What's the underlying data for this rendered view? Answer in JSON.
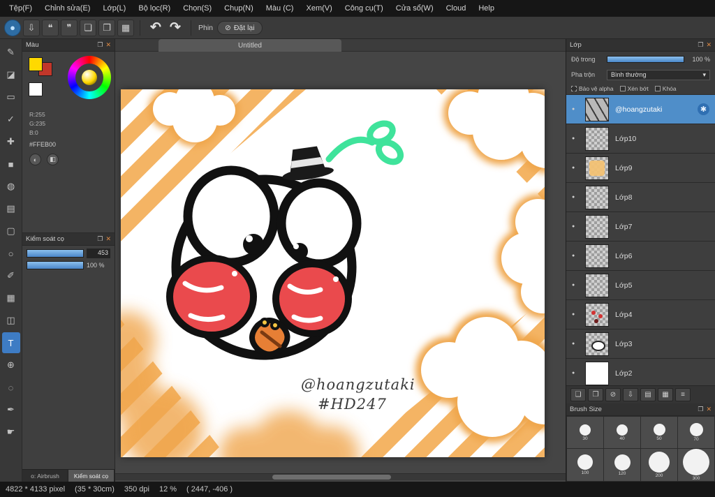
{
  "menubar": {
    "items": [
      "Tệp(F)",
      "Chỉnh sửa(E)",
      "Lớp(L)",
      "Bộ lọc(R)",
      "Chọn(S)",
      "Chụp(N)",
      "Màu (C)",
      "Xem(V)",
      "Công cụ(T)",
      "Cửa sổ(W)",
      "Cloud",
      "Help"
    ]
  },
  "toolbar": {
    "icons": [
      {
        "name": "primary-tool-icon",
        "glyph": "●"
      },
      {
        "name": "save-icon",
        "glyph": "⇩"
      },
      {
        "name": "speech-filled-icon",
        "glyph": "❝"
      },
      {
        "name": "speech-outline-icon",
        "glyph": "❞"
      },
      {
        "name": "page-icon",
        "glyph": "❏"
      },
      {
        "name": "panels-icon",
        "glyph": "❐"
      },
      {
        "name": "grid-icon",
        "glyph": "▦"
      }
    ],
    "undo_glyph": "↶",
    "redo_glyph": "↷",
    "pen_label": "Phin",
    "reset_icon": "⊘",
    "reset_label": "Đặt lại"
  },
  "tools": {
    "items": [
      {
        "name": "pen-tool",
        "glyph": "✎"
      },
      {
        "name": "eraser-tool",
        "glyph": "◪"
      },
      {
        "name": "select-tool",
        "glyph": "▭"
      },
      {
        "name": "select-pen-tool",
        "glyph": "✓"
      },
      {
        "name": "move-tool",
        "glyph": "✚"
      },
      {
        "name": "fill-rect-tool",
        "glyph": "■"
      },
      {
        "name": "bucket-tool",
        "glyph": "◍"
      },
      {
        "name": "gradient-tool",
        "glyph": "▤"
      },
      {
        "name": "frame-tool",
        "glyph": "▢"
      },
      {
        "name": "ellipse-tool",
        "glyph": "○"
      },
      {
        "name": "eyedropper-tool",
        "glyph": "✐"
      },
      {
        "name": "divide-tool",
        "glyph": "▦"
      },
      {
        "name": "panel-tool",
        "glyph": "◫"
      },
      {
        "name": "text-tool",
        "glyph": "T",
        "selected": true
      },
      {
        "name": "zoom-tool",
        "glyph": "⊕"
      },
      {
        "name": "lasso-tool",
        "glyph": "◌"
      },
      {
        "name": "pen2-tool",
        "glyph": "✒"
      },
      {
        "name": "hand-tool",
        "glyph": "☛"
      }
    ]
  },
  "color_panel": {
    "title": "Màu",
    "popout_icon": "❐",
    "close_icon": "✕",
    "r_label": "R:255",
    "g_label": "G:235",
    "b_label": "B:0",
    "hex": "#FFEB00",
    "btn1_glyph": "◐",
    "btn2_glyph": "◧"
  },
  "brush_panel": {
    "title": "Kiểm soát cọ",
    "popout_icon": "❐",
    "close_icon": "✕",
    "size_value": "453",
    "opacity_value": "100 %"
  },
  "dock_tabs": {
    "tab1": "o: Airbrush",
    "tab2": "Kiểm soát cọ"
  },
  "canvas": {
    "tab_title": "Untitled",
    "signature_line1": "@hoangzutaki",
    "signature_line2": "#HD247"
  },
  "layers": {
    "title": "Lớp",
    "popout_icon": "❐",
    "close_icon": "✕",
    "opacity_label": "Độ trong",
    "opacity_value": "100 %",
    "blend_label": "Pha trộn",
    "blend_value": "Bình thường",
    "dropdown_arrow": "▾",
    "checkboxes": [
      "Bảo vệ alpha",
      "Xén bớt",
      "Khóa"
    ],
    "eye_glyph": "●",
    "gear_glyph": "✱",
    "items": [
      {
        "name": "@hoangzutaki",
        "thumb": "scribble",
        "selected": true
      },
      {
        "name": "Lớp10",
        "thumb": "checker"
      },
      {
        "name": "Lớp9",
        "thumb": "orange"
      },
      {
        "name": "Lớp8",
        "thumb": "checker"
      },
      {
        "name": "Lớp7",
        "thumb": "checker"
      },
      {
        "name": "Lớp6",
        "thumb": "checker"
      },
      {
        "name": "Lớp5",
        "thumb": "checker"
      },
      {
        "name": "Lớp4",
        "thumb": "red"
      },
      {
        "name": "Lớp3",
        "thumb": "circle"
      },
      {
        "name": "Lớp2",
        "thumb": "white"
      }
    ],
    "buttons": [
      {
        "name": "add-layer-button",
        "glyph": "❏"
      },
      {
        "name": "duplicate-layer-button",
        "glyph": "❐"
      },
      {
        "name": "delete-layer-button",
        "glyph": "⊘"
      },
      {
        "name": "merge-down-button",
        "glyph": "⇩"
      },
      {
        "name": "folder-button",
        "glyph": "▤"
      },
      {
        "name": "convert-layer-button",
        "glyph": "▦"
      },
      {
        "name": "layer-menu-button",
        "glyph": "≡"
      }
    ]
  },
  "brush_size": {
    "title": "Brush Size",
    "popout_icon": "❐",
    "close_icon": "✕",
    "rows": [
      [
        30,
        40,
        50,
        70
      ],
      [
        100,
        120,
        200,
        300
      ]
    ]
  },
  "statusbar": {
    "size": "4822 * 4133 pixel",
    "cm": "(35 * 30cm)",
    "dpi": "350 dpi",
    "zoom": "12 %",
    "coords": "( 2447, -406 )"
  },
  "colors": {
    "accent": "#4a86c8",
    "selected_layer": "#4f8ec9",
    "canvas_orange": "#f4b464",
    "cheek_red": "#ea4a4d",
    "sprout_green": "#3fe39b"
  }
}
